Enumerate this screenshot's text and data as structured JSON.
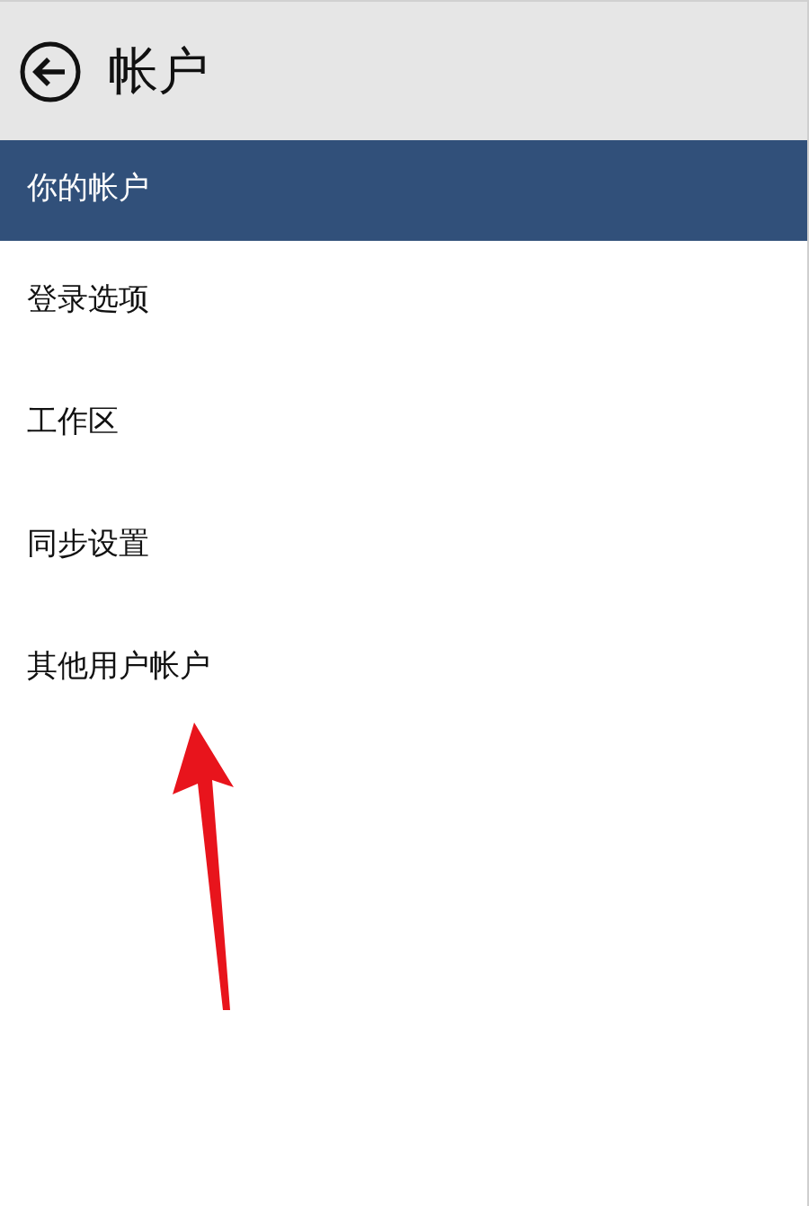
{
  "header": {
    "title": "帐户"
  },
  "menu": [
    {
      "label": "你的帐户",
      "selected": true
    },
    {
      "label": "登录选项",
      "selected": false
    },
    {
      "label": "工作区",
      "selected": false
    },
    {
      "label": "同步设置",
      "selected": false
    },
    {
      "label": "其他用户帐户",
      "selected": false
    }
  ]
}
